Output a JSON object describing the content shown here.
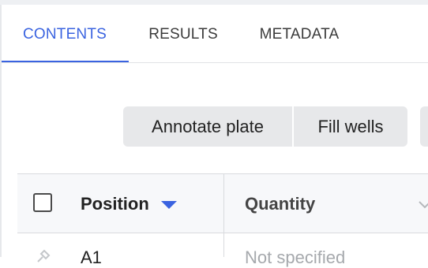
{
  "tabs": [
    {
      "label": "CONTENTS",
      "active": true
    },
    {
      "label": "RESULTS",
      "active": false
    },
    {
      "label": "METADATA",
      "active": false
    }
  ],
  "toolbar": {
    "annotate_label": "Annotate plate",
    "fill_label": "Fill wells"
  },
  "table": {
    "columns": {
      "position": "Position",
      "quantity": "Quantity"
    },
    "rows": [
      {
        "position": "A1",
        "quantity": "Not specified"
      }
    ]
  },
  "colors": {
    "accent": "#3a63e0",
    "button_bg": "#e7e8ea",
    "placeholder_text": "#a6a9ad"
  },
  "icons": {
    "sort": "caret-down-icon",
    "column_menu": "chevron-down-icon",
    "row_marker": "pin-icon"
  }
}
